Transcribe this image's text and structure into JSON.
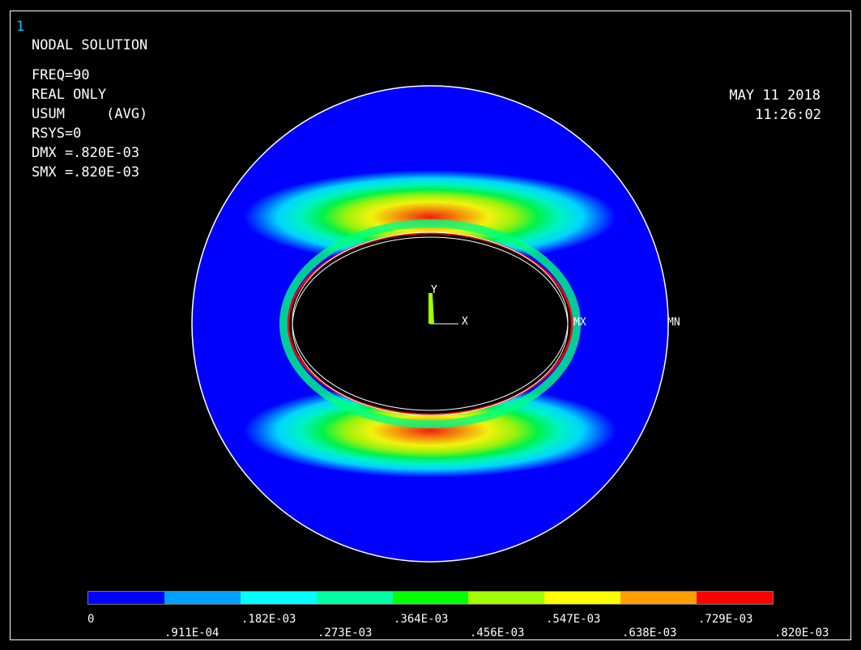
{
  "window_number": "1",
  "header": {
    "title": "NODAL SOLUTION",
    "lines": [
      "FREQ=90",
      "REAL ONLY",
      "USUM     (AVG)",
      "RSYS=0",
      "DMX =.820E-03",
      "SMX =.820E-03"
    ]
  },
  "datetime": {
    "date": "MAY 11 2018",
    "time": "11:26:02"
  },
  "plot": {
    "triad": {
      "y_label": "Y",
      "x_label": "X"
    },
    "mx_label": "MX",
    "mn_label": "MN"
  },
  "legend": {
    "colors": [
      "#0000ff",
      "#00a0ff",
      "#00ffff",
      "#00ffa0",
      "#00ff00",
      "#a0ff00",
      "#ffff00",
      "#ffa000",
      "#ff0000"
    ],
    "top_labels": [
      "0",
      ".182E-03",
      ".364E-03",
      ".547E-03",
      ".729E-03"
    ],
    "bottom_labels": [
      ".911E-04",
      ".273E-03",
      ".456E-03",
      ".638E-03",
      ".820E-03"
    ]
  }
}
